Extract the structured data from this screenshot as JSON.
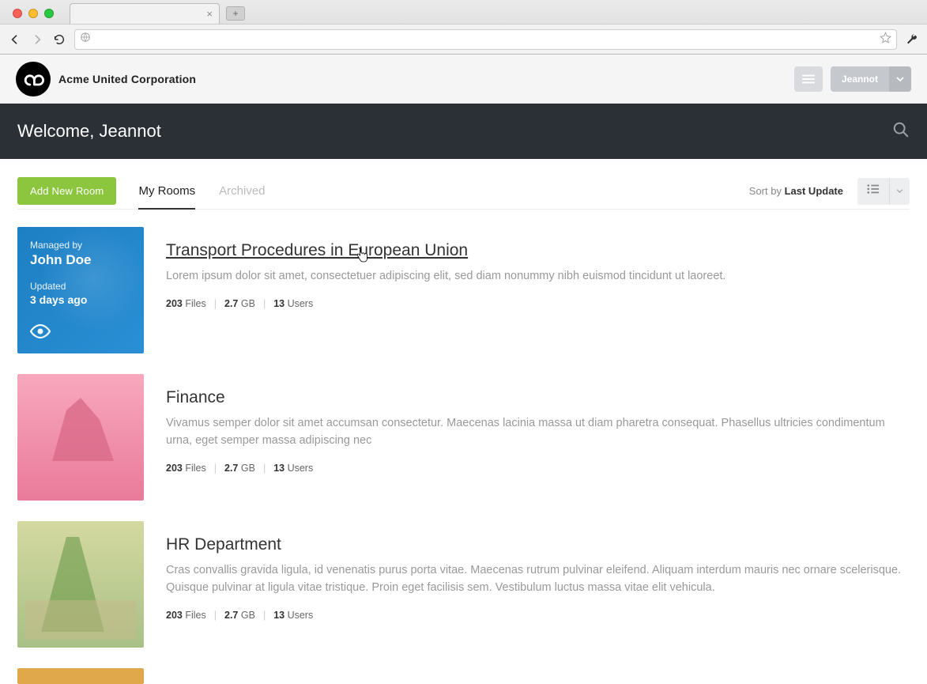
{
  "browser": {
    "new_tab_symbol": "+",
    "tab_close_symbol": "×"
  },
  "header": {
    "company_name": "Acme United Corporation",
    "user_name": "Jeannot"
  },
  "welcome": {
    "text": "Welcome, Jeannot"
  },
  "controls": {
    "add_room_label": "Add New Room",
    "tabs": {
      "my_rooms": "My Rooms",
      "archived": "Archived"
    },
    "sort_label": "Sort by",
    "sort_value": "Last Update"
  },
  "rooms": [
    {
      "managed_by_label": "Managed by",
      "manager": "John Doe",
      "updated_label": "Updated",
      "updated_value": "3 days ago",
      "title": "Transport Procedures in European Union",
      "hovered": true,
      "description": "Lorem ipsum dolor sit amet, consectetuer adipiscing elit, sed diam nonummy nibh euismod tincidunt ut laoreet.",
      "files_count": "203",
      "files_label": "Files",
      "size_value": "2.7",
      "size_unit": "GB",
      "users_count": "13",
      "users_label": "Users"
    },
    {
      "title": "Finance",
      "description": "Vivamus semper dolor sit amet accumsan consectetur. Maecenas lacinia massa ut diam pharetra consequat. Phasellus ultricies condimentum urna, eget semper massa adipiscing nec",
      "files_count": "203",
      "files_label": "Files",
      "size_value": "2.7",
      "size_unit": "GB",
      "users_count": "13",
      "users_label": "Users"
    },
    {
      "title": "HR Department",
      "description": "Cras convallis gravida ligula, id venenatis purus porta vitae. Maecenas rutrum pulvinar eleifend. Aliquam interdum mauris nec ornare scelerisque. Quisque pulvinar at ligula vitae tristique. Proin eget facilisis sem. Vestibulum luctus massa vitae elit vehicula.",
      "files_count": "203",
      "files_label": "Files",
      "size_value": "2.7",
      "size_unit": "GB",
      "users_count": "13",
      "users_label": "Users"
    }
  ]
}
